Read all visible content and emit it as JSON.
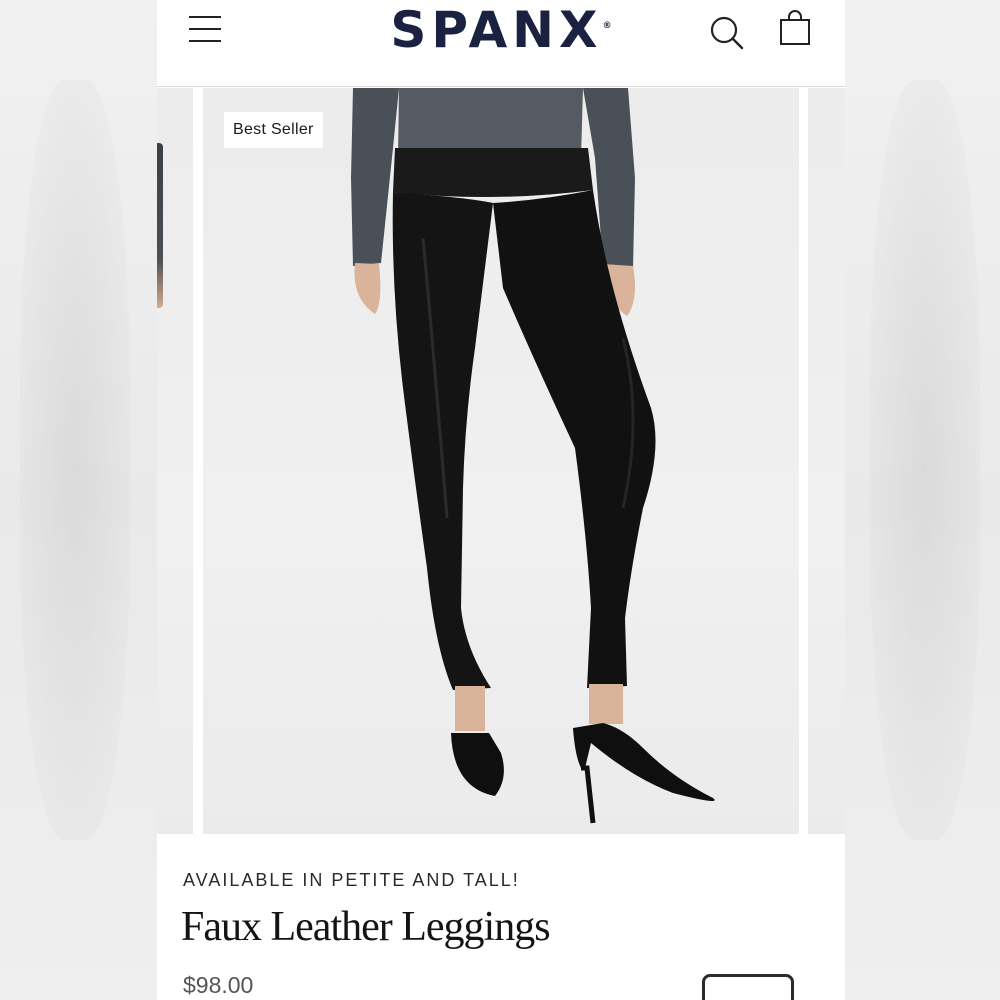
{
  "header": {
    "brand": "SPANX",
    "trademark": "®",
    "menu_icon": "hamburger-menu-icon",
    "search_icon": "search-icon",
    "bag_icon": "shopping-bag-icon"
  },
  "carousel": {
    "badge": "Best Seller"
  },
  "product": {
    "availability": "AVAILABLE IN PETITE AND TALL!",
    "title": "Faux Leather Leggings",
    "price": "$98.00"
  },
  "colors": {
    "brand": "#1b2140",
    "top_garment": "#4a5058",
    "leggings": "#111111",
    "skin": "#d9b39a"
  }
}
